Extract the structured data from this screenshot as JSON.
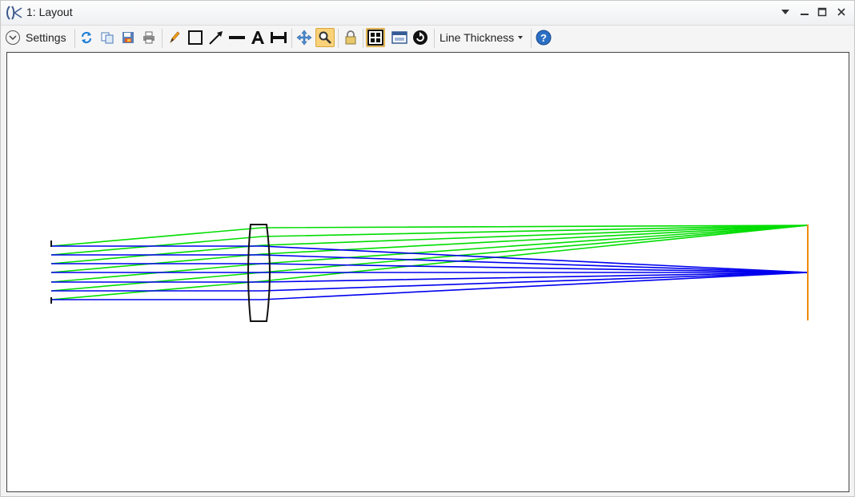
{
  "window": {
    "title": "1: Layout",
    "controls": [
      "dropdown",
      "minimize",
      "maximize",
      "close"
    ]
  },
  "toolbar": {
    "settings_label": "Settings",
    "line_thickness_label": "Line Thickness",
    "buttons": [
      {
        "name": "refresh-icon"
      },
      {
        "name": "copy-icon"
      },
      {
        "name": "save-icon"
      },
      {
        "name": "print-icon"
      },
      {
        "name": "pencil-icon"
      },
      {
        "name": "rectangle-icon"
      },
      {
        "name": "arrow-line-icon"
      },
      {
        "name": "line-icon"
      },
      {
        "name": "text-icon"
      },
      {
        "name": "dimension-icon"
      },
      {
        "name": "pan-icon"
      },
      {
        "name": "zoom-icon",
        "active": true
      },
      {
        "name": "lock-icon"
      },
      {
        "name": "grid-layout-icon",
        "active": true
      },
      {
        "name": "window-icon"
      },
      {
        "name": "rotate-icon"
      },
      {
        "name": "help-icon"
      }
    ]
  },
  "colors": {
    "ray_field_1": "#0000ee",
    "ray_field_2": "#00dd00",
    "lens": "#111111",
    "image_plane": "#f08a00",
    "accent_active": "#f9d27a"
  }
}
